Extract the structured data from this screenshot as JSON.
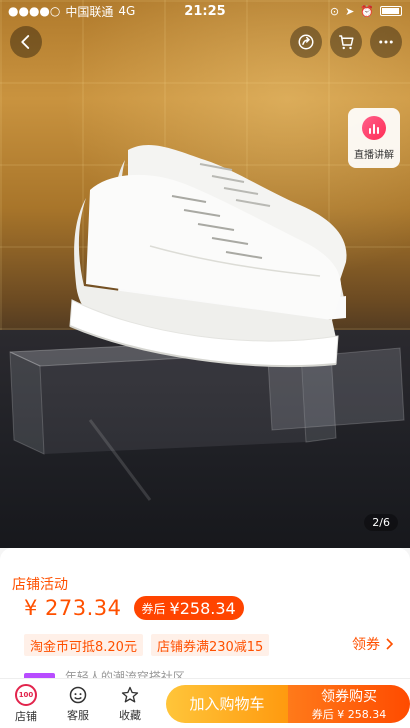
{
  "status_bar": {
    "carrier": "中国联通",
    "network": "4G",
    "time": "21:25"
  },
  "hero": {
    "page_indicator": "2/6",
    "live_label": "直播讲解"
  },
  "product": {
    "activity_label": "店铺活动",
    "price": "¥ 273.34",
    "after_coupon_label": "券后",
    "after_coupon_price": "¥258.34",
    "chip_coins": "淘金币可抵8.20元",
    "chip_shop_coupon": "店铺券满230减15",
    "get_coupon": "领券",
    "peek_text": "年轻人的潮流穿搭社区"
  },
  "bottom_bar": {
    "shop_label": "店铺",
    "shop_avatar_text": "100",
    "service_label": "客服",
    "favorite_label": "收藏",
    "add_to_cart": "加入购物车",
    "buy_title": "领券购买",
    "buy_sub": "券后 ¥ 258.34"
  },
  "colors": {
    "accent": "#ff5000",
    "cart_gradient": [
      "#ffc53a",
      "#ff9a0f"
    ],
    "buy_gradient": [
      "#ff7a1a",
      "#ff4b00"
    ]
  },
  "icons": {
    "back": "chevron-left-icon",
    "share": "share-icon",
    "cart": "cart-icon",
    "more": "more-icon",
    "live": "live-icon",
    "service": "chat-icon",
    "favorite": "star-icon"
  }
}
